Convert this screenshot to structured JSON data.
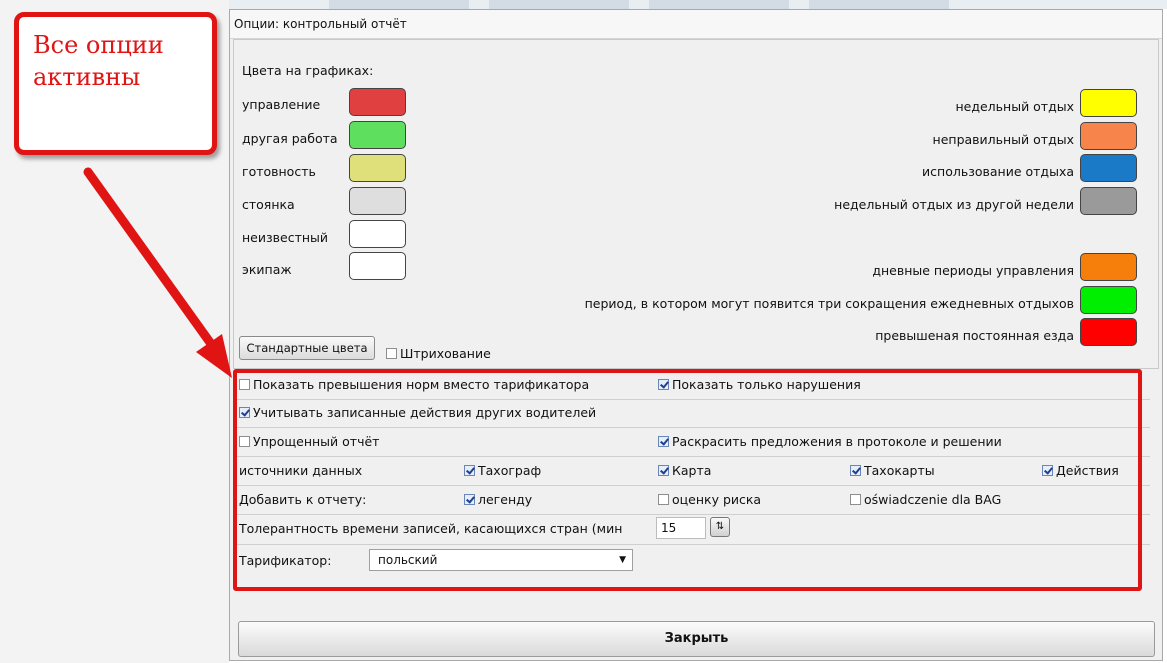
{
  "annotation": {
    "text": "Все опции активны"
  },
  "dialog": {
    "title": "Опции: контрольный отчёт",
    "colors_heading": "Цвета на графиках:",
    "left_colors": [
      {
        "label": "управление",
        "color": "#e04040"
      },
      {
        "label": "другая работа",
        "color": "#5ee05e"
      },
      {
        "label": "готовность",
        "color": "#e0e07a"
      },
      {
        "label": "стоянка",
        "color": "#dedede"
      },
      {
        "label": "неизвестный",
        "color": "#ffffff"
      },
      {
        "label": "экипаж",
        "color": "#ffffff"
      }
    ],
    "right_colors": [
      {
        "label": "недельный отдых",
        "color": "#ffff00"
      },
      {
        "label": "неправильный отдых",
        "color": "#f7844a"
      },
      {
        "label": "использование отдыха",
        "color": "#1a7ac8"
      },
      {
        "label": "недельный отдых из другой недели",
        "color": "#9a9a9a"
      },
      {
        "label": "дневные периоды управления",
        "color": "#f57f0a"
      },
      {
        "label": "период, в котором могут появится три сокращения ежедневных отдыхов",
        "color": "#00ef00"
      },
      {
        "label": "превышеная постоянная езда",
        "color": "#ff0000"
      }
    ],
    "standard_colors_button": "Стандартные цвета",
    "hatching": {
      "label": "Штрихование",
      "checked": false
    },
    "options": {
      "show_exceed": {
        "label": "Показать превышения норм вместо тарификатора",
        "checked": false
      },
      "show_violations": {
        "label": "Показать только нарушения",
        "checked": true
      },
      "other_drivers": {
        "label": "Учитывать записанные действия других водителей",
        "checked": true
      },
      "simplified": {
        "label": "Упрощенный отчёт",
        "checked": false
      },
      "colorize": {
        "label": "Раскрасить предложения в протоколе и решении",
        "checked": true
      },
      "sources_label": "источники данных",
      "sources": [
        {
          "label": "Тахограф",
          "checked": true
        },
        {
          "label": "Карта",
          "checked": true
        },
        {
          "label": "Тахокарты",
          "checked": true
        },
        {
          "label": "Действия",
          "checked": true
        }
      ],
      "add_label": "Добавить к отчету:",
      "add": [
        {
          "label": "легенду",
          "checked": true
        },
        {
          "label": "оценку риска",
          "checked": false
        },
        {
          "label": "oświadczenie dla BAG",
          "checked": false
        }
      ],
      "tolerance_label": "Толерантность времени записей, касающихся стран (мин",
      "tolerance_value": "15",
      "tariff_label": "Тарификатор:",
      "tariff_value": "польский"
    },
    "close_button": "Закрыть"
  },
  "colors": {
    "annotation_red": "#e11414"
  }
}
